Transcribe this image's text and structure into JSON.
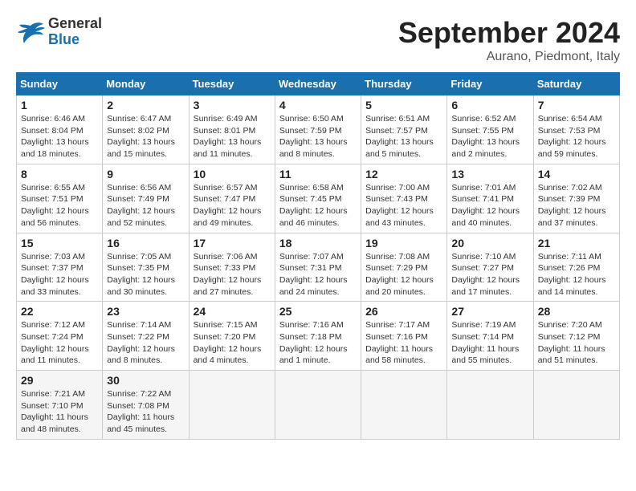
{
  "logo": {
    "line1": "General",
    "line2": "Blue"
  },
  "title": "September 2024",
  "subtitle": "Aurano, Piedmont, Italy",
  "headers": [
    "Sunday",
    "Monday",
    "Tuesday",
    "Wednesday",
    "Thursday",
    "Friday",
    "Saturday"
  ],
  "weeks": [
    [
      {
        "day": "1",
        "lines": [
          "Sunrise: 6:46 AM",
          "Sunset: 8:04 PM",
          "Daylight: 13 hours",
          "and 18 minutes."
        ]
      },
      {
        "day": "2",
        "lines": [
          "Sunrise: 6:47 AM",
          "Sunset: 8:02 PM",
          "Daylight: 13 hours",
          "and 15 minutes."
        ]
      },
      {
        "day": "3",
        "lines": [
          "Sunrise: 6:49 AM",
          "Sunset: 8:01 PM",
          "Daylight: 13 hours",
          "and 11 minutes."
        ]
      },
      {
        "day": "4",
        "lines": [
          "Sunrise: 6:50 AM",
          "Sunset: 7:59 PM",
          "Daylight: 13 hours",
          "and 8 minutes."
        ]
      },
      {
        "day": "5",
        "lines": [
          "Sunrise: 6:51 AM",
          "Sunset: 7:57 PM",
          "Daylight: 13 hours",
          "and 5 minutes."
        ]
      },
      {
        "day": "6",
        "lines": [
          "Sunrise: 6:52 AM",
          "Sunset: 7:55 PM",
          "Daylight: 13 hours",
          "and 2 minutes."
        ]
      },
      {
        "day": "7",
        "lines": [
          "Sunrise: 6:54 AM",
          "Sunset: 7:53 PM",
          "Daylight: 12 hours",
          "and 59 minutes."
        ]
      }
    ],
    [
      {
        "day": "8",
        "lines": [
          "Sunrise: 6:55 AM",
          "Sunset: 7:51 PM",
          "Daylight: 12 hours",
          "and 56 minutes."
        ]
      },
      {
        "day": "9",
        "lines": [
          "Sunrise: 6:56 AM",
          "Sunset: 7:49 PM",
          "Daylight: 12 hours",
          "and 52 minutes."
        ]
      },
      {
        "day": "10",
        "lines": [
          "Sunrise: 6:57 AM",
          "Sunset: 7:47 PM",
          "Daylight: 12 hours",
          "and 49 minutes."
        ]
      },
      {
        "day": "11",
        "lines": [
          "Sunrise: 6:58 AM",
          "Sunset: 7:45 PM",
          "Daylight: 12 hours",
          "and 46 minutes."
        ]
      },
      {
        "day": "12",
        "lines": [
          "Sunrise: 7:00 AM",
          "Sunset: 7:43 PM",
          "Daylight: 12 hours",
          "and 43 minutes."
        ]
      },
      {
        "day": "13",
        "lines": [
          "Sunrise: 7:01 AM",
          "Sunset: 7:41 PM",
          "Daylight: 12 hours",
          "and 40 minutes."
        ]
      },
      {
        "day": "14",
        "lines": [
          "Sunrise: 7:02 AM",
          "Sunset: 7:39 PM",
          "Daylight: 12 hours",
          "and 37 minutes."
        ]
      }
    ],
    [
      {
        "day": "15",
        "lines": [
          "Sunrise: 7:03 AM",
          "Sunset: 7:37 PM",
          "Daylight: 12 hours",
          "and 33 minutes."
        ]
      },
      {
        "day": "16",
        "lines": [
          "Sunrise: 7:05 AM",
          "Sunset: 7:35 PM",
          "Daylight: 12 hours",
          "and 30 minutes."
        ]
      },
      {
        "day": "17",
        "lines": [
          "Sunrise: 7:06 AM",
          "Sunset: 7:33 PM",
          "Daylight: 12 hours",
          "and 27 minutes."
        ]
      },
      {
        "day": "18",
        "lines": [
          "Sunrise: 7:07 AM",
          "Sunset: 7:31 PM",
          "Daylight: 12 hours",
          "and 24 minutes."
        ]
      },
      {
        "day": "19",
        "lines": [
          "Sunrise: 7:08 AM",
          "Sunset: 7:29 PM",
          "Daylight: 12 hours",
          "and 20 minutes."
        ]
      },
      {
        "day": "20",
        "lines": [
          "Sunrise: 7:10 AM",
          "Sunset: 7:27 PM",
          "Daylight: 12 hours",
          "and 17 minutes."
        ]
      },
      {
        "day": "21",
        "lines": [
          "Sunrise: 7:11 AM",
          "Sunset: 7:26 PM",
          "Daylight: 12 hours",
          "and 14 minutes."
        ]
      }
    ],
    [
      {
        "day": "22",
        "lines": [
          "Sunrise: 7:12 AM",
          "Sunset: 7:24 PM",
          "Daylight: 12 hours",
          "and 11 minutes."
        ]
      },
      {
        "day": "23",
        "lines": [
          "Sunrise: 7:14 AM",
          "Sunset: 7:22 PM",
          "Daylight: 12 hours",
          "and 8 minutes."
        ]
      },
      {
        "day": "24",
        "lines": [
          "Sunrise: 7:15 AM",
          "Sunset: 7:20 PM",
          "Daylight: 12 hours",
          "and 4 minutes."
        ]
      },
      {
        "day": "25",
        "lines": [
          "Sunrise: 7:16 AM",
          "Sunset: 7:18 PM",
          "Daylight: 12 hours",
          "and 1 minute."
        ]
      },
      {
        "day": "26",
        "lines": [
          "Sunrise: 7:17 AM",
          "Sunset: 7:16 PM",
          "Daylight: 11 hours",
          "and 58 minutes."
        ]
      },
      {
        "day": "27",
        "lines": [
          "Sunrise: 7:19 AM",
          "Sunset: 7:14 PM",
          "Daylight: 11 hours",
          "and 55 minutes."
        ]
      },
      {
        "day": "28",
        "lines": [
          "Sunrise: 7:20 AM",
          "Sunset: 7:12 PM",
          "Daylight: 11 hours",
          "and 51 minutes."
        ]
      }
    ],
    [
      {
        "day": "29",
        "lines": [
          "Sunrise: 7:21 AM",
          "Sunset: 7:10 PM",
          "Daylight: 11 hours",
          "and 48 minutes."
        ]
      },
      {
        "day": "30",
        "lines": [
          "Sunrise: 7:22 AM",
          "Sunset: 7:08 PM",
          "Daylight: 11 hours",
          "and 45 minutes."
        ]
      },
      {
        "day": "",
        "lines": []
      },
      {
        "day": "",
        "lines": []
      },
      {
        "day": "",
        "lines": []
      },
      {
        "day": "",
        "lines": []
      },
      {
        "day": "",
        "lines": []
      }
    ]
  ]
}
